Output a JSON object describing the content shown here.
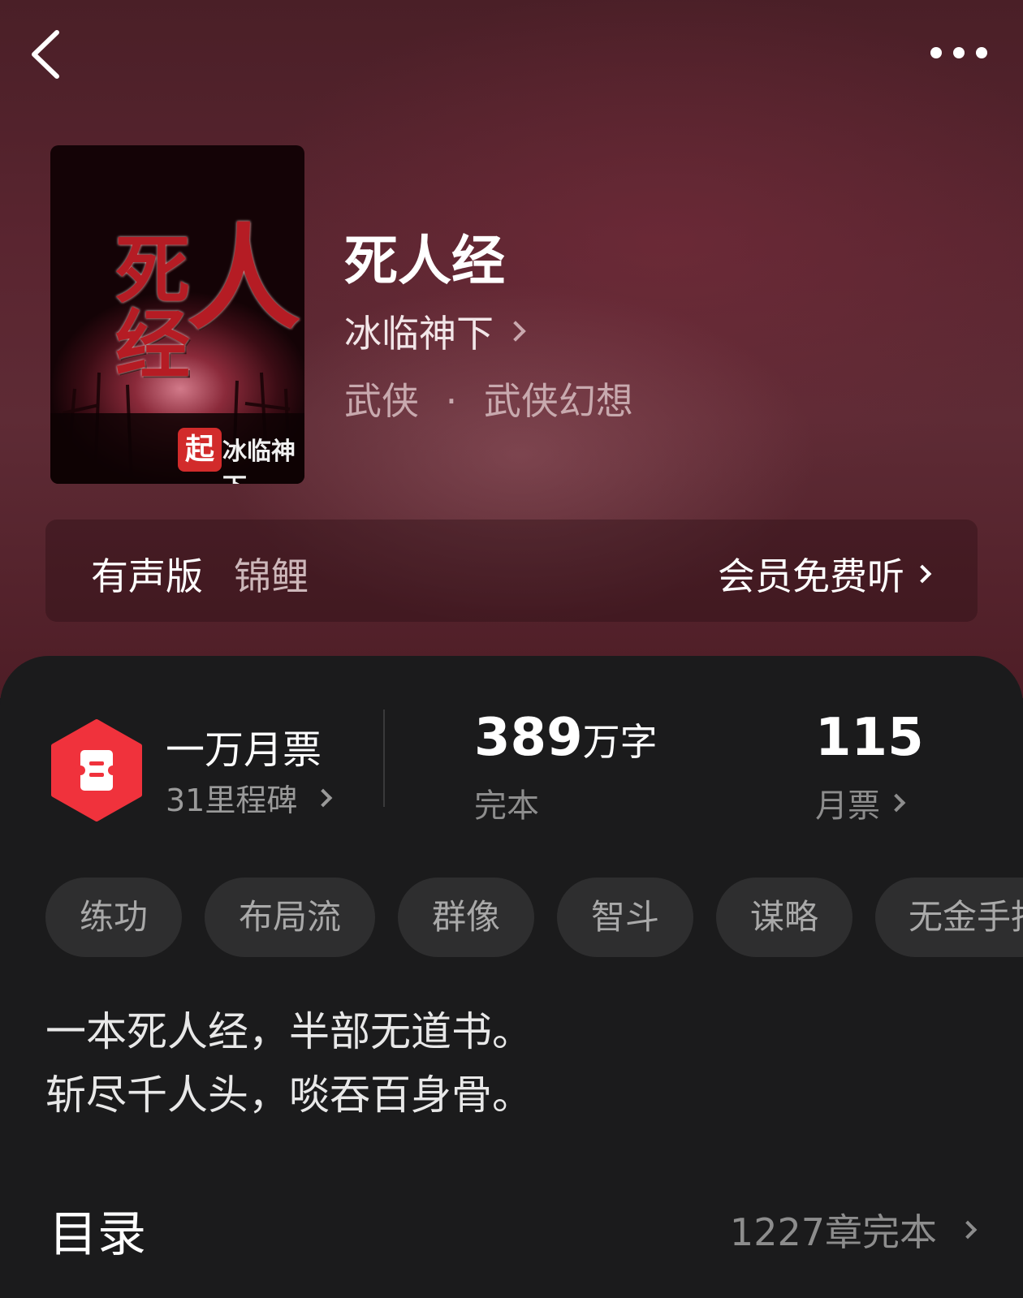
{
  "book": {
    "title": "死人经",
    "author": "冰临神下",
    "genre": "武侠",
    "subgenre": "武侠幻想",
    "genre_separator": "·"
  },
  "cover": {
    "title_chars": [
      "死",
      "经",
      "人"
    ],
    "brand": "起",
    "author": "冰临神下"
  },
  "audio": {
    "label": "有声版",
    "narrator": "锦鲤",
    "cta": "会员免费听"
  },
  "stats": {
    "ticket_title": "一万月票",
    "milestone": "31里程碑",
    "word_count": "389",
    "word_unit": "万字",
    "status": "完本",
    "monthly_votes": "115",
    "monthly_votes_label": "月票"
  },
  "tags": [
    "练功",
    "布局流",
    "群像",
    "智斗",
    "谋略",
    "无金手指"
  ],
  "synopsis": [
    "一本死人经，半部无道书。",
    "斩尽千人头，啖吞百身骨。"
  ],
  "toc": {
    "title": "目录",
    "count": "1227章完本"
  },
  "icons": {
    "back": "back-arrow-icon",
    "more": "more-dots-icon",
    "badge": "ticket-badge-icon",
    "chevron": "chevron-right-icon"
  },
  "colors": {
    "badge_red": "#f0323c",
    "panel_bg": "#1b1b1c",
    "hero_bg": "#5a2530"
  }
}
